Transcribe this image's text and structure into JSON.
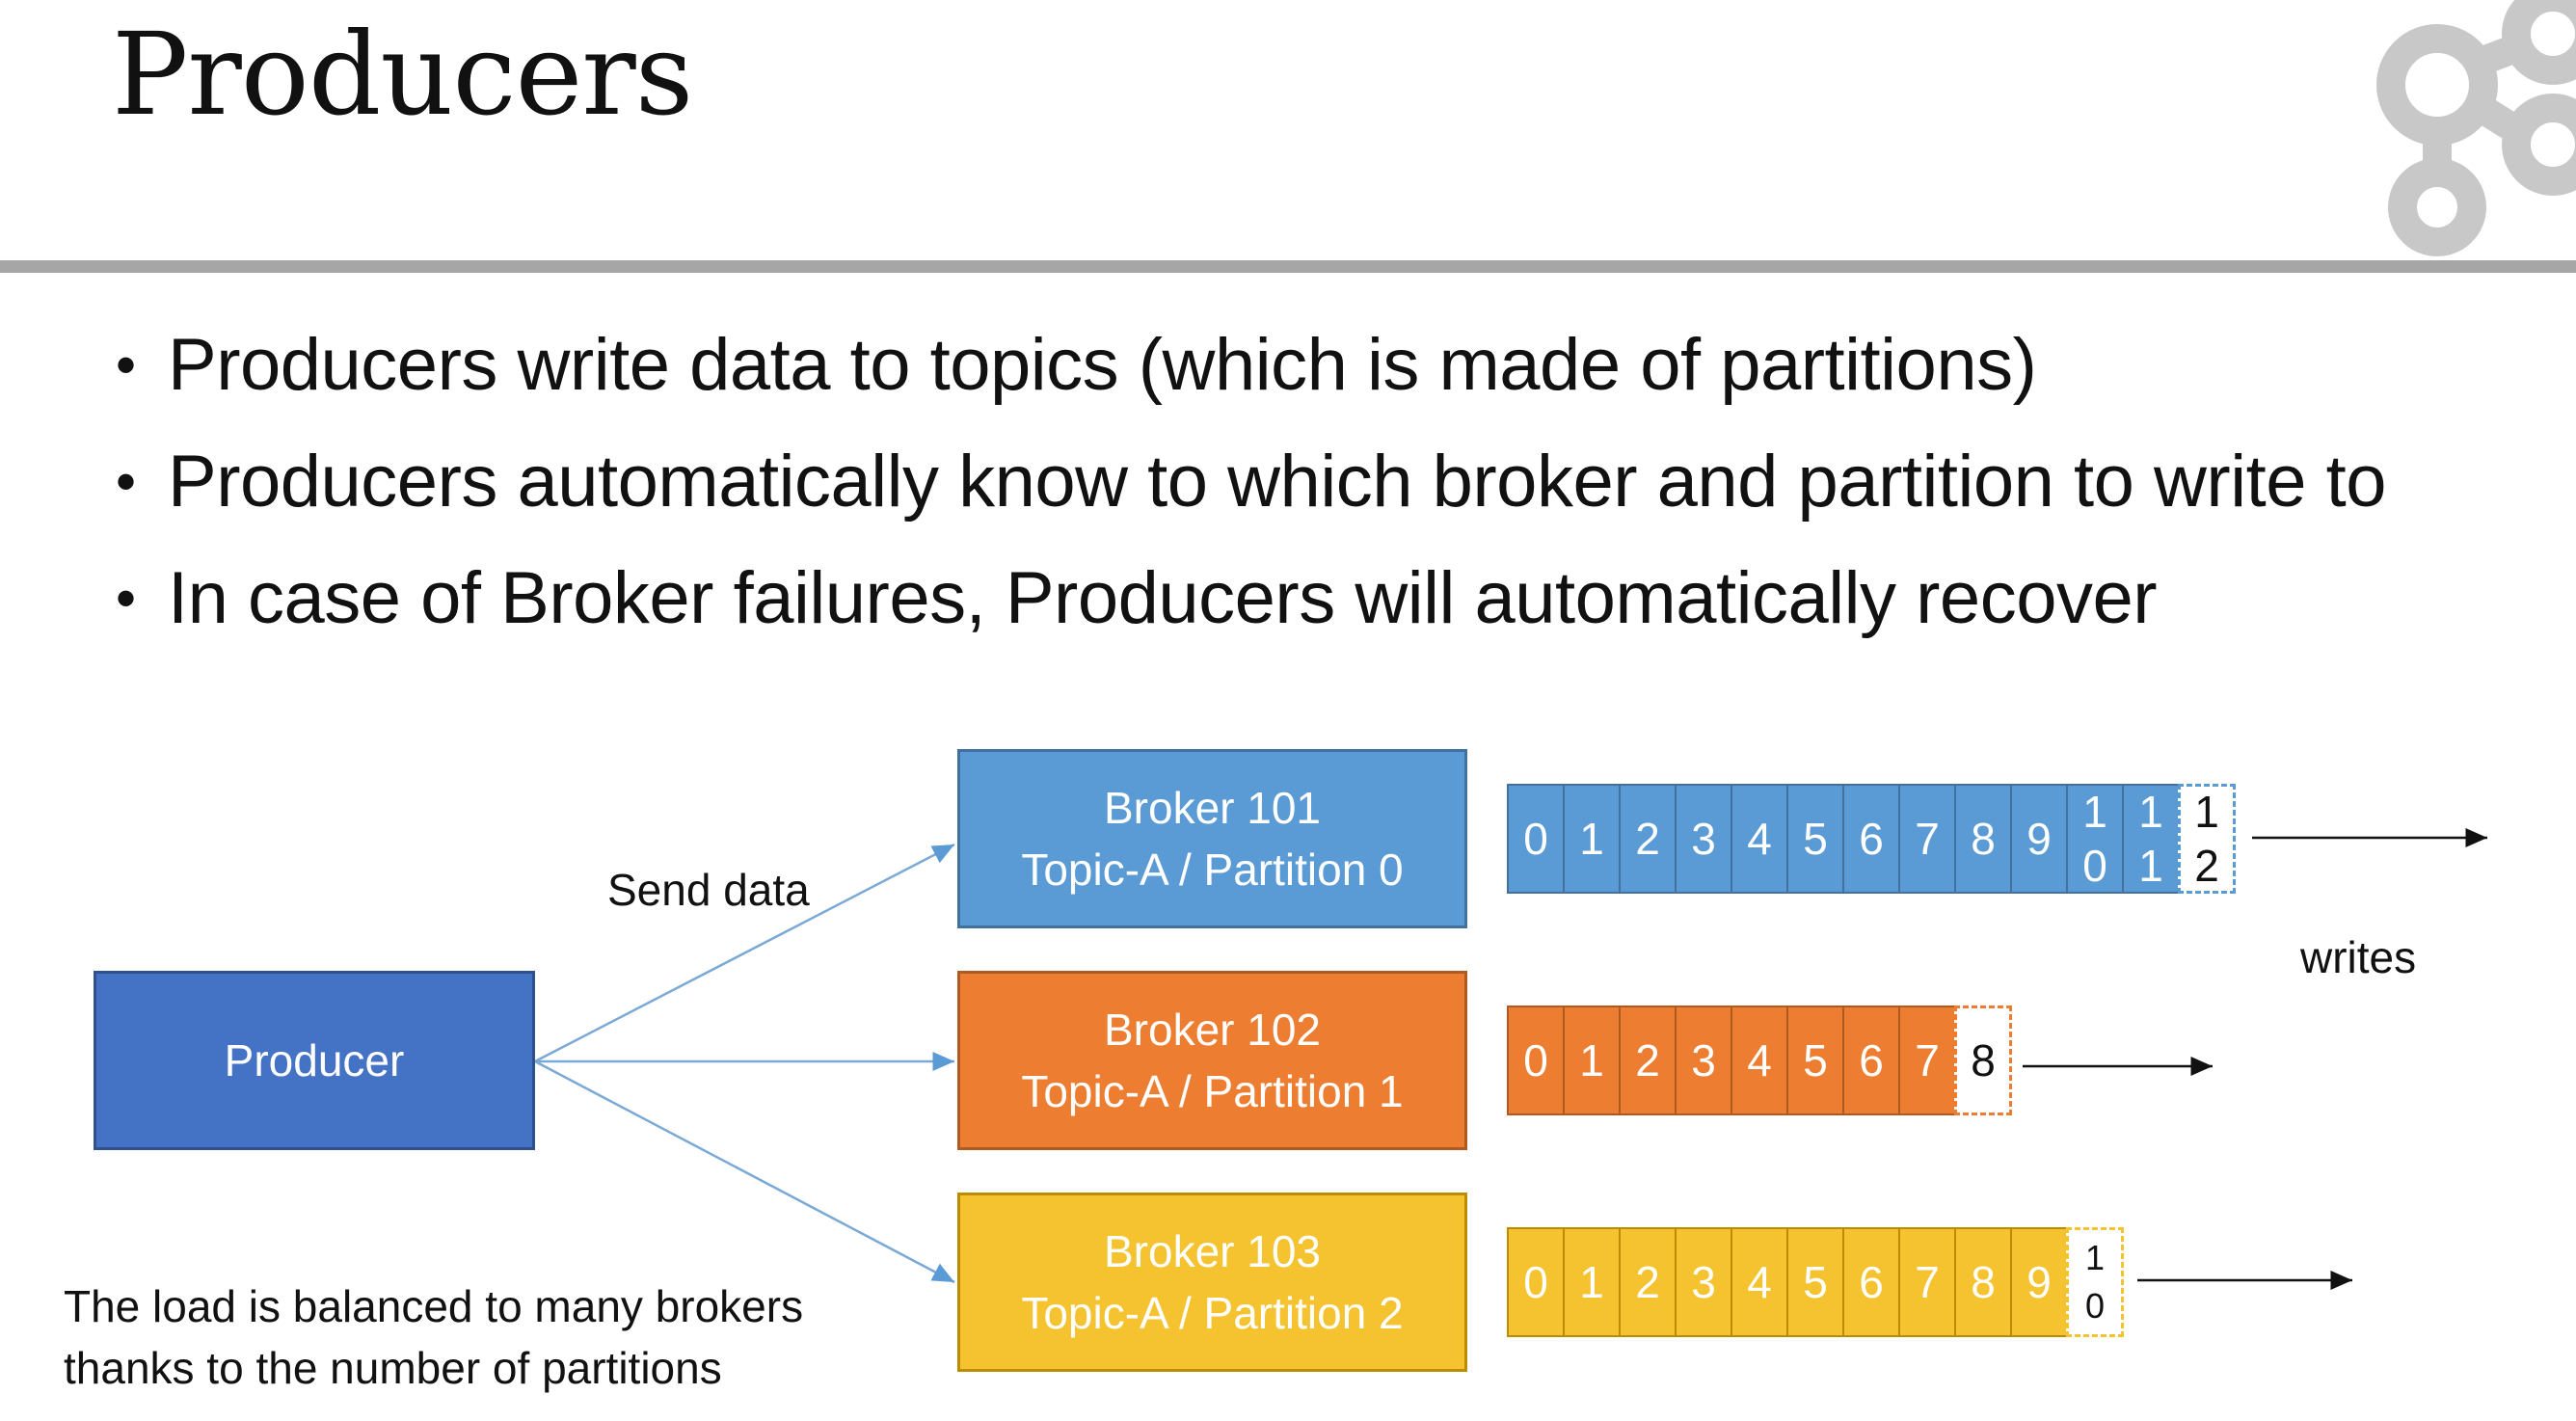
{
  "slide": {
    "title": "Producers",
    "bullets": [
      "Producers write data to topics (which is made of partitions)",
      "Producers automatically know to which broker and partition to write to",
      "In case of Broker failures, Producers will automatically recover"
    ]
  },
  "diagram": {
    "producer_label": "Producer",
    "send_label": "Send data",
    "writes_label": "writes",
    "footnote_line1": "The load is balanced to many brokers",
    "footnote_line2": "thanks to the number of partitions",
    "brokers": [
      {
        "name": "Broker 101",
        "topic": "Topic-A / Partition 0",
        "color": "#5b9bd5",
        "offsets": [
          "0",
          "1",
          "2",
          "3",
          "4",
          "5",
          "6",
          "7",
          "8",
          "9",
          [
            "1",
            "0"
          ],
          [
            "1",
            "1"
          ]
        ],
        "next_offset": [
          "1",
          "2"
        ]
      },
      {
        "name": "Broker 102",
        "topic": "Topic-A / Partition 1",
        "color": "#ed7d31",
        "offsets": [
          "0",
          "1",
          "2",
          "3",
          "4",
          "5",
          "6",
          "7"
        ],
        "next_offset": [
          "8"
        ]
      },
      {
        "name": "Broker 103",
        "topic": "Topic-A / Partition 2",
        "color": "#f4c32f",
        "offsets": [
          "0",
          "1",
          "2",
          "3",
          "4",
          "5",
          "6",
          "7",
          "8",
          "9"
        ],
        "next_offset": [
          "1",
          "0"
        ]
      }
    ]
  },
  "colors": {
    "producer": "#4472c4",
    "arrow": "#7aa9d6",
    "rule": "#a6a6a6",
    "logo": "#c8c8c8"
  }
}
